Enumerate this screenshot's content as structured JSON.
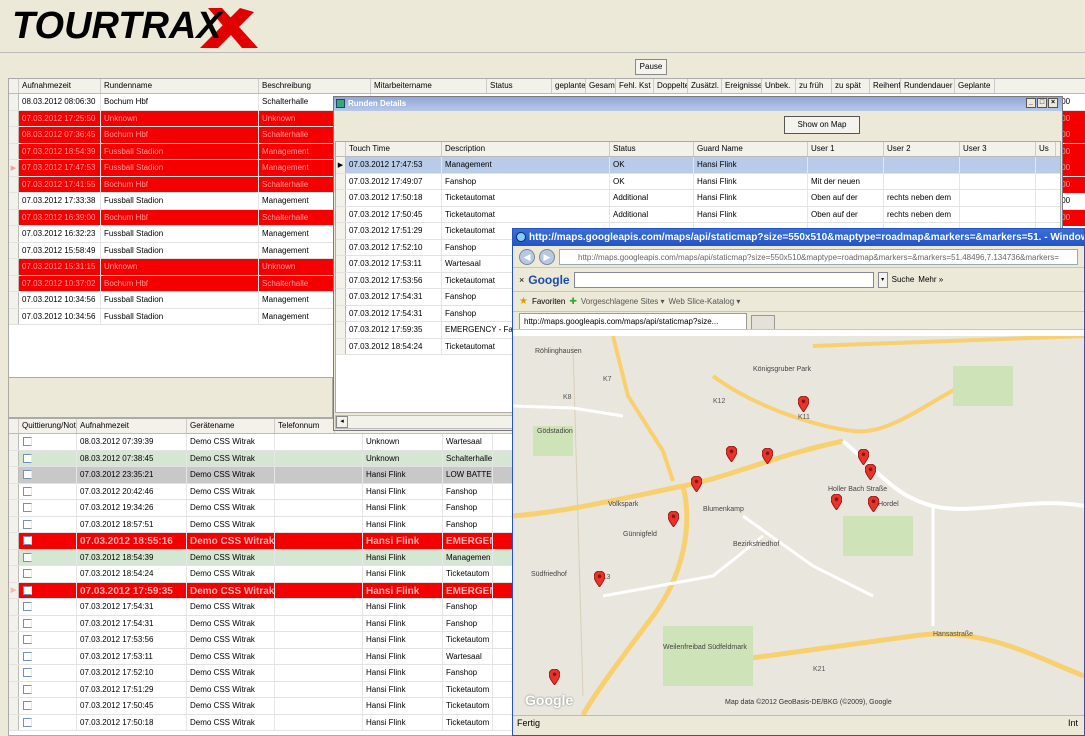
{
  "app": {
    "logo_text": "TOURTRAX",
    "pause_label": "Pause"
  },
  "tour_grid": {
    "columns": [
      "Aufnahmezeit",
      "Rundenname",
      "Beschreibung",
      "Mitarbeitername",
      "Status",
      "geplante",
      "Gesamt",
      "Fehl. Kst",
      "Doppelte",
      "Zusätzl.",
      "Ereignisse",
      "Unbek.",
      "zu früh",
      "zu spät",
      "Reihenf.",
      "Rundendauer",
      "Geplante"
    ],
    "rows": [
      {
        "time": "08.03.2012 08:06:30",
        "name": "Bochum Hbf",
        "desc": "Schalterhalle",
        "red": false,
        "right": ":00"
      },
      {
        "time": "07.03.2012 17:25:50",
        "name": "Unknown",
        "desc": "Unknown",
        "red": true,
        "right": ":00"
      },
      {
        "time": "08.03.2012 07:36:45",
        "name": "Bochum Hbf",
        "desc": "Schalterhalle",
        "red": true,
        "right": ":00"
      },
      {
        "time": "07.03.2012 18:54:39",
        "name": "Fussball Stadion",
        "desc": "Management",
        "red": true,
        "right": ":00"
      },
      {
        "time": "07.03.2012 17:47:53",
        "name": "Fussball Stadion",
        "desc": "Management",
        "red": true,
        "right": ":00"
      },
      {
        "time": "07.03.2012 17:41:55",
        "name": "Bochum Hbf",
        "desc": "Schalterhalle",
        "red": true,
        "right": ":00"
      },
      {
        "time": "07.03.2012 17:33:38",
        "name": "Fussball Stadion",
        "desc": "Management",
        "red": false,
        "right": ":00"
      },
      {
        "time": "07.03.2012 16:39:00",
        "name": "Bochum Hbf",
        "desc": "Schalterhalle",
        "red": true,
        "right": ":00"
      },
      {
        "time": "07.03.2012 16:32:23",
        "name": "Fussball Stadion",
        "desc": "Management",
        "red": false,
        "right": ""
      },
      {
        "time": "07.03.2012 15:58:49",
        "name": "Fussball Stadion",
        "desc": "Management",
        "red": false,
        "right": ""
      },
      {
        "time": "07.03.2012 15:31:15",
        "name": "Unknown",
        "desc": "Unknown",
        "red": true,
        "right": ""
      },
      {
        "time": "07.03.2012 10:37:02",
        "name": "Bochum Hbf",
        "desc": "Schalterhalle",
        "red": true,
        "right": ""
      },
      {
        "time": "07.03.2012 10:34:56",
        "name": "Fussball Stadion",
        "desc": "Management",
        "red": false,
        "right": ""
      },
      {
        "time": "07.03.2012 10:34:56",
        "name": "Fussball Stadion",
        "desc": "Management",
        "red": false,
        "right": ""
      }
    ]
  },
  "event_grid": {
    "columns": [
      "Quittierung/Notiz",
      "Aufnahmezeit",
      "Gerätename",
      "Telefonnum"
    ],
    "rows": [
      {
        "time": "08.03.2012 07:39:39",
        "dev": "Demo CSS Witrak",
        "who": "Unknown",
        "loc": "Wartesaal",
        "style": ""
      },
      {
        "time": "08.03.2012 07:38:45",
        "dev": "Demo CSS Witrak",
        "who": "Unknown",
        "loc": "Schalterhalle",
        "style": "green"
      },
      {
        "time": "07.03.2012 23:35:21",
        "dev": "Demo CSS Witrak",
        "who": "Hansi Flink",
        "loc": "LOW BATTE",
        "style": "gray"
      },
      {
        "time": "07.03.2012 20:42:46",
        "dev": "Demo CSS Witrak",
        "who": "Hansi Flink",
        "loc": "Fanshop",
        "style": ""
      },
      {
        "time": "07.03.2012 19:34:26",
        "dev": "Demo CSS Witrak",
        "who": "Hansi Flink",
        "loc": "Fanshop",
        "style": ""
      },
      {
        "time": "07.03.2012 18:57:51",
        "dev": "Demo CSS Witrak",
        "who": "Hansi Flink",
        "loc": "Fanshop",
        "style": ""
      },
      {
        "time": "07.03.2012 18:55:16",
        "dev": "Demo CSS Witrak",
        "who": "Hansi Flink",
        "loc": "EMERGEN",
        "style": "redbig"
      },
      {
        "time": "07.03.2012 18:54:39",
        "dev": "Demo CSS Witrak",
        "who": "Hansi Flink",
        "loc": "Managemen",
        "style": "green"
      },
      {
        "time": "07.03.2012 18:54:24",
        "dev": "Demo CSS Witrak",
        "who": "Hansi Flink",
        "loc": "Ticketautom",
        "style": ""
      },
      {
        "time": "07.03.2012 17:59:35",
        "dev": "Demo CSS Witrak",
        "who": "Hansi Flink",
        "loc": "EMERGEN",
        "style": "redbig"
      },
      {
        "time": "07.03.2012 17:54:31",
        "dev": "Demo CSS Witrak",
        "who": "Hansi Flink",
        "loc": "Fanshop",
        "style": ""
      },
      {
        "time": "07.03.2012 17:54:31",
        "dev": "Demo CSS Witrak",
        "who": "Hansi Flink",
        "loc": "Fanshop",
        "style": ""
      },
      {
        "time": "07.03.2012 17:53:56",
        "dev": "Demo CSS Witrak",
        "who": "Hansi Flink",
        "loc": "Ticketautom",
        "style": ""
      },
      {
        "time": "07.03.2012 17:53:11",
        "dev": "Demo CSS Witrak",
        "who": "Hansi Flink",
        "loc": "Wartesaal",
        "style": ""
      },
      {
        "time": "07.03.2012 17:52:10",
        "dev": "Demo CSS Witrak",
        "who": "Hansi Flink",
        "loc": "Fanshop",
        "style": ""
      },
      {
        "time": "07.03.2012 17:51:29",
        "dev": "Demo CSS Witrak",
        "who": "Hansi Flink",
        "loc": "Ticketautom",
        "style": ""
      },
      {
        "time": "07.03.2012 17:50:45",
        "dev": "Demo CSS Witrak",
        "who": "Hansi Flink",
        "loc": "Ticketautom",
        "style": ""
      },
      {
        "time": "07.03.2012 17:50:18",
        "dev": "Demo CSS Witrak",
        "who": "Hansi Flink",
        "loc": "Ticketautom",
        "style": ""
      }
    ]
  },
  "details": {
    "title": "Runden Details",
    "show_map_label": "Show on Map",
    "columns": [
      "Touch Time",
      "Description",
      "Status",
      "Guard Name",
      "User 1",
      "User 2",
      "User 3",
      "Us"
    ],
    "rows": [
      {
        "t": "07.03.2012 17:47:53",
        "d": "Management",
        "s": "OK",
        "g": "Hansi Flink",
        "u1": "",
        "u2": ""
      },
      {
        "t": "07.03.2012 17:49:07",
        "d": "Fanshop",
        "s": "OK",
        "g": "Hansi Flink",
        "u1": "Mit der neuen",
        "u2": ""
      },
      {
        "t": "07.03.2012 17:50:18",
        "d": "Ticketautomat",
        "s": "Additional",
        "g": "Hansi Flink",
        "u1": "Oben auf der",
        "u2": "rechts neben dem"
      },
      {
        "t": "07.03.2012 17:50:45",
        "d": "Ticketautomat",
        "s": "Additional",
        "g": "Hansi Flink",
        "u1": "Oben auf der",
        "u2": "rechts neben dem"
      },
      {
        "t": "07.03.2012 17:51:29",
        "d": "Ticketautomat",
        "s": "",
        "g": "",
        "u1": "",
        "u2": ""
      },
      {
        "t": "07.03.2012 17:52:10",
        "d": "Fanshop",
        "s": "",
        "g": "",
        "u1": "",
        "u2": ""
      },
      {
        "t": "07.03.2012 17:53:11",
        "d": "Wartesaal",
        "s": "",
        "g": "",
        "u1": "",
        "u2": ""
      },
      {
        "t": "07.03.2012 17:53:56",
        "d": "Ticketautomat",
        "s": "",
        "g": "",
        "u1": "",
        "u2": ""
      },
      {
        "t": "07.03.2012 17:54:31",
        "d": "Fanshop",
        "s": "",
        "g": "",
        "u1": "",
        "u2": ""
      },
      {
        "t": "07.03.2012 17:54:31",
        "d": "Fanshop",
        "s": "",
        "g": "",
        "u1": "",
        "u2": ""
      },
      {
        "t": "07.03.2012 17:59:35",
        "d": "EMERGENCY - Fa",
        "s": "",
        "g": "",
        "u1": "",
        "u2": ""
      },
      {
        "t": "07.03.2012 18:54:24",
        "d": "Ticketautomat",
        "s": "",
        "g": "",
        "u1": "",
        "u2": ""
      }
    ]
  },
  "browser": {
    "title": "http://maps.googleapis.com/maps/api/staticmap?size=550x510&maptype=roadmap&markers=&markers=51. - Windows Internet",
    "address": "http://maps.googleapis.com/maps/api/staticmap?size=550x510&maptype=roadmap&markers=&markers=51.48496,7.134736&markers=",
    "google_label": "Google",
    "suche_label": "Suche",
    "mehr_label": "Mehr »",
    "favorites_label": "Favoriten",
    "fav1": "Vorgeschlagene Sites ▾",
    "fav2": "Web Slice-Katalog ▾",
    "tab_label": "http://maps.googleapis.com/maps/api/staticmap?size...",
    "status": "Fertig",
    "status_right": "Int",
    "map_places": [
      "Röhlinghausen",
      "Königsgruber Park",
      "Gödstadion",
      "Volkspark",
      "Blumenkamp",
      "Günnigfeld",
      "Bezirksfriedhof",
      "Südfriedhof",
      "Weilenfreibad Südfeldmark",
      "Hordel",
      "Holler Bach Straße"
    ],
    "map_roads": [
      "K8",
      "K7",
      "K11",
      "K12",
      "K13",
      "K21",
      "Hansastraße"
    ],
    "map_copyright": "Map data ©2012 GeoBasis-DE/BKG (©2009), Google",
    "google_watermark": "Google"
  }
}
